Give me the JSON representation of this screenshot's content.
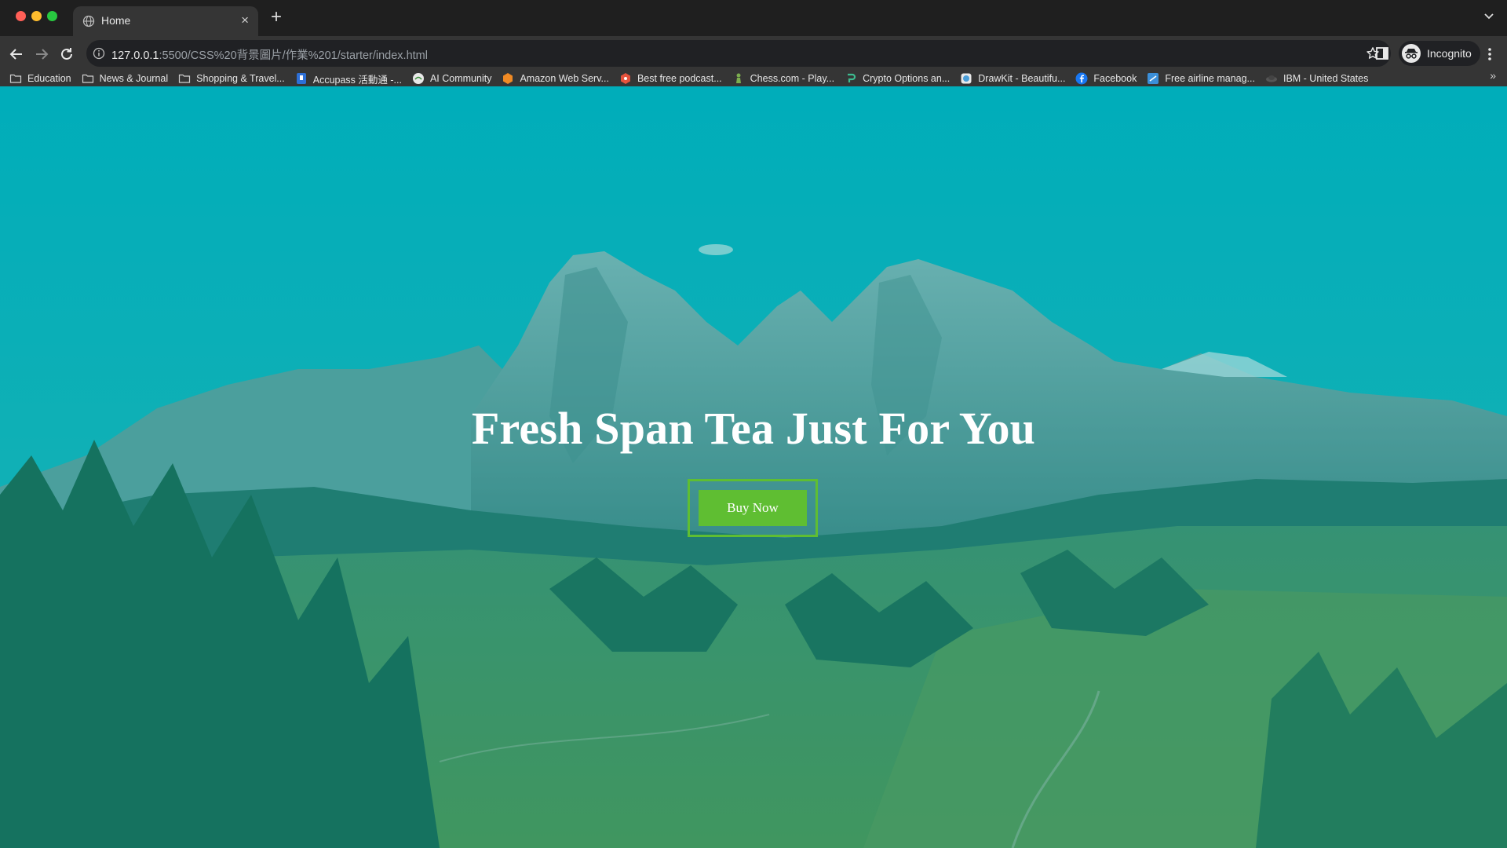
{
  "browser": {
    "tab": {
      "title": "Home",
      "close": "×"
    },
    "new_tab": "+",
    "url": {
      "host": "127.0.0.1",
      "rest": ":5500/CSS%20背景圖片/作業%201/starter/index.html"
    },
    "profile": "Incognito",
    "bookmarks": [
      {
        "label": "Education",
        "icon": "folder-icon"
      },
      {
        "label": "News & Journal",
        "icon": "folder-icon"
      },
      {
        "label": "Shopping & Travel...",
        "icon": "folder-icon"
      },
      {
        "label": "Accupass 活動通 -...",
        "icon": "accupass-icon"
      },
      {
        "label": "AI Community",
        "icon": "ai-community-icon"
      },
      {
        "label": "Amazon Web Serv...",
        "icon": "aws-icon"
      },
      {
        "label": "Best free podcast...",
        "icon": "podcast-icon"
      },
      {
        "label": "Chess.com - Play...",
        "icon": "chess-icon"
      },
      {
        "label": "Crypto Options an...",
        "icon": "crypto-icon"
      },
      {
        "label": "DrawKit - Beautifu...",
        "icon": "drawkit-icon"
      },
      {
        "label": "Facebook",
        "icon": "facebook-icon"
      },
      {
        "label": "Free airline manag...",
        "icon": "airline-icon"
      },
      {
        "label": "IBM - United States",
        "icon": "ibm-icon"
      }
    ],
    "bookmarks_more": "»"
  },
  "hero": {
    "title": "Fresh Span Tea Just For You",
    "button_label": "Buy Now"
  },
  "colors": {
    "accent_green": "#5fbe32",
    "overlay_teal": "#00a5aa"
  }
}
